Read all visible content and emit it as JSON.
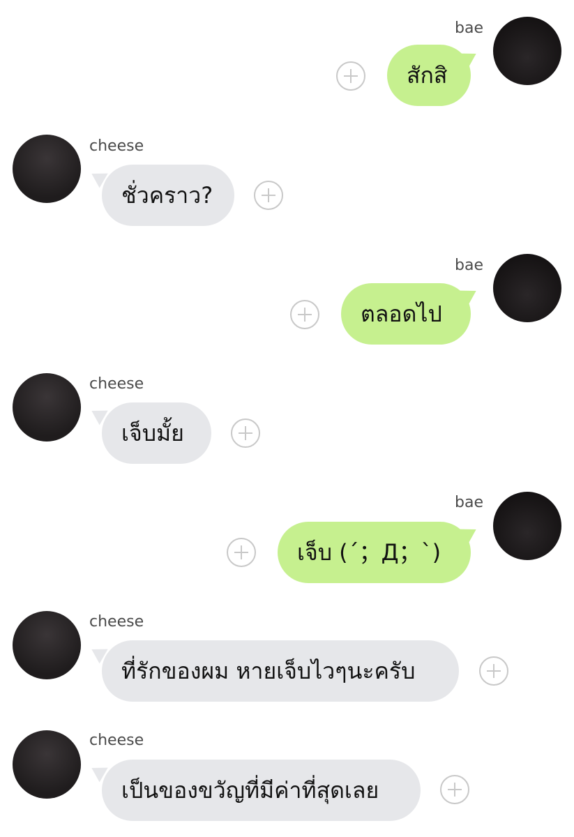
{
  "messages": [
    {
      "sender": "bae",
      "text": "สักสิ"
    },
    {
      "sender": "cheese",
      "text": "ชั่วคราว?"
    },
    {
      "sender": "bae",
      "text": "ตลอดไป"
    },
    {
      "sender": "cheese",
      "text": "เจ็บมั้ย"
    },
    {
      "sender": "bae",
      "text": "เจ็บ (´；Д；`)"
    },
    {
      "sender": "cheese",
      "text": "ที่รักของผม หายเจ็บไวๆนะครับ"
    },
    {
      "sender": "cheese",
      "text": "เป็นของขวัญที่มีค่าที่สุดเลย"
    }
  ],
  "colors": {
    "sent_bubble": "#c6f08f",
    "received_bubble": "#e6e7ea",
    "name_text": "#4a4a4a",
    "plus_outline": "#c8c8c8"
  },
  "icons": {
    "reaction": "plus-circle-icon"
  }
}
